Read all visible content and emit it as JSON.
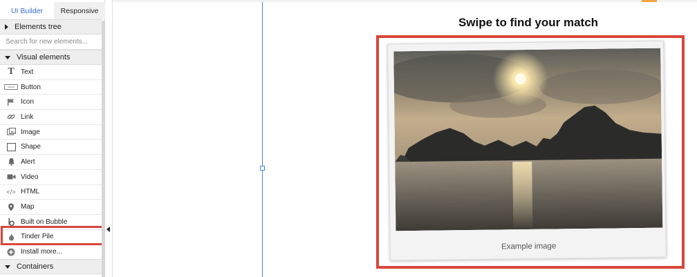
{
  "sidebar": {
    "tabs": [
      {
        "label": "UI Builder",
        "active": true
      },
      {
        "label": "Responsive",
        "active": false
      }
    ],
    "elements_tree_label": "Elements tree",
    "search_placeholder": "Search for new elements...",
    "visual_elements_label": "Visual elements",
    "items": [
      {
        "label": "Text",
        "icon": "text-icon"
      },
      {
        "label": "Button",
        "icon": "button-icon"
      },
      {
        "label": "Icon",
        "icon": "flag-icon"
      },
      {
        "label": "Link",
        "icon": "link-icon"
      },
      {
        "label": "Image",
        "icon": "image-icon"
      },
      {
        "label": "Shape",
        "icon": "shape-icon"
      },
      {
        "label": "Alert",
        "icon": "bell-icon"
      },
      {
        "label": "Video",
        "icon": "video-icon"
      },
      {
        "label": "HTML",
        "icon": "code-icon"
      },
      {
        "label": "Map",
        "icon": "map-pin-icon"
      },
      {
        "label": "Built on Bubble",
        "icon": "bubble-logo-icon"
      },
      {
        "label": "Tinder Pile",
        "icon": "flame-icon",
        "highlighted": true
      },
      {
        "label": "Install more...",
        "icon": "plus-circle-icon"
      }
    ],
    "containers_label": "Containers"
  },
  "canvas": {
    "title": "Swipe to find your match",
    "card_caption": "Example image"
  },
  "colors": {
    "accent": "#3a6bd1",
    "highlight": "#d9453a",
    "guide": "#4a7fd4",
    "marker": "#f0a540"
  }
}
